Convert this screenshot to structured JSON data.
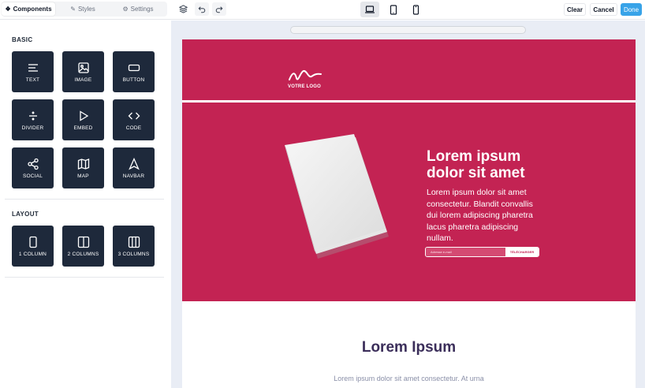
{
  "tabs": [
    {
      "label": "Components",
      "icon": "components-icon",
      "active": true
    },
    {
      "label": "Styles",
      "icon": "brush-icon",
      "active": false
    },
    {
      "label": "Settings",
      "icon": "gear-icon",
      "active": false
    }
  ],
  "toolbar": {
    "clear_label": "Clear",
    "cancel_label": "Cancel",
    "done_label": "Done",
    "active_device": "desktop"
  },
  "sidebar": {
    "basic_title": "BASIC",
    "layout_title": "LAYOUT",
    "basic_items": [
      {
        "label": "TEXT",
        "icon": "text-icon"
      },
      {
        "label": "IMAGE",
        "icon": "image-icon"
      },
      {
        "label": "BUTTON",
        "icon": "button-icon"
      },
      {
        "label": "DIVIDER",
        "icon": "divider-icon"
      },
      {
        "label": "EMBED",
        "icon": "play-icon"
      },
      {
        "label": "CODE",
        "icon": "code-icon"
      },
      {
        "label": "SOCIAL",
        "icon": "share-icon"
      },
      {
        "label": "MAP",
        "icon": "map-icon"
      },
      {
        "label": "NAVBAR",
        "icon": "navigation-icon"
      }
    ],
    "layout_items": [
      {
        "label": "1 COLUMN",
        "icon": "one-column-icon"
      },
      {
        "label": "2 COLUMNS",
        "icon": "two-columns-icon"
      },
      {
        "label": "3 COLUMNS",
        "icon": "three-columns-icon"
      }
    ]
  },
  "email": {
    "logo_text": "VOTRE LOGO",
    "hero_title": "Lorem ipsum dolor sit amet",
    "hero_body": "Lorem ipsum dolor sit amet consectetur. Blandit convallis dui lorem adipiscing pharetra lacus pharetra adipiscing nullam.",
    "email_placeholder": "Adresse e-mail",
    "download_label": "TÉLÉCHARGER",
    "section_heading": "Lorem Ipsum",
    "section_body": "Lorem ipsum dolor sit amet consectetur. At urna",
    "brand_color": "#c32353"
  }
}
